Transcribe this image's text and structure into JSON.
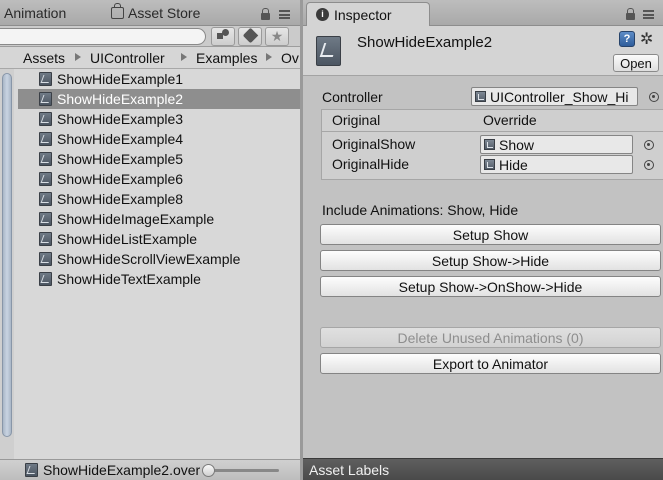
{
  "left_panel": {
    "tabs": [
      {
        "label": "Animation"
      },
      {
        "label": "Asset Store",
        "icon": "asset-store-icon"
      }
    ],
    "search": {
      "value": "",
      "placeholder": ""
    },
    "breadcrumb": [
      "Assets",
      "UIController",
      "Examples",
      "Ov"
    ],
    "items": [
      {
        "label": "ShowHideExample1",
        "selected": false
      },
      {
        "label": "ShowHideExample2",
        "selected": true
      },
      {
        "label": "ShowHideExample3",
        "selected": false
      },
      {
        "label": "ShowHideExample4",
        "selected": false
      },
      {
        "label": "ShowHideExample5",
        "selected": false
      },
      {
        "label": "ShowHideExample6",
        "selected": false
      },
      {
        "label": "ShowHideExample8",
        "selected": false
      },
      {
        "label": "ShowHideImageExample",
        "selected": false
      },
      {
        "label": "ShowHideListExample",
        "selected": false
      },
      {
        "label": "ShowHideScrollViewExample",
        "selected": false
      },
      {
        "label": "ShowHideTextExample",
        "selected": false
      }
    ],
    "footer": {
      "filename": "ShowHideExample2.over",
      "zoom": 0
    }
  },
  "inspector": {
    "tab_label": "Inspector",
    "tab_icon_glyph": "i",
    "title": "ShowHideExample2",
    "help_glyph": "?",
    "gear_glyph": "✲",
    "open_label": "Open",
    "controller_label": "Controller",
    "controller_value": "UIController_Show_Hi",
    "table": {
      "col_original": "Original",
      "col_override": "Override",
      "rows": [
        {
          "original": "OriginalShow",
          "override": "Show"
        },
        {
          "original": "OriginalHide",
          "override": "Hide"
        }
      ]
    },
    "include_text": "Include Animations: Show, Hide",
    "buttons": {
      "setup_show": "Setup Show",
      "setup_show_hide": "Setup Show->Hide",
      "setup_show_onshow_hide": "Setup Show->OnShow->Hide",
      "delete_unused": "Delete Unused Animations (0)",
      "export": "Export to Animator"
    },
    "asset_labels": "Asset Labels"
  },
  "colors": {
    "selection": "#8e8e8e",
    "scroll_thumb": "#b7c3d2",
    "footer_bar": "#555555"
  }
}
